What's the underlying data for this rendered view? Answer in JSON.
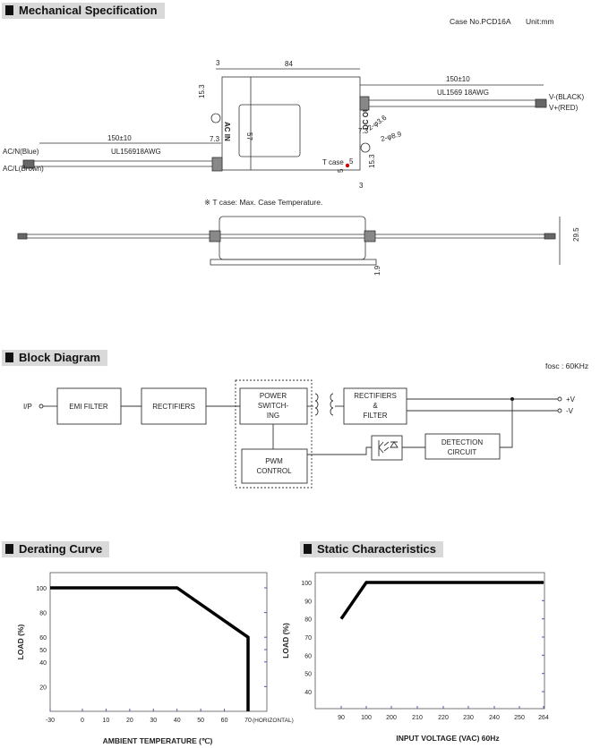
{
  "sections": {
    "mechanical": "Mechanical Specification",
    "block": "Block Diagram",
    "derating": "Derating Curve",
    "static": "Static Characteristics"
  },
  "mechanical": {
    "case_no": "Case No.PCD16A",
    "unit": "Unit:mm",
    "dim_84": "84",
    "dim_3_top": "3",
    "dim_15_3_left": "15.3",
    "dim_7_3_left": "7.3",
    "dim_57": "57",
    "ac_in": "AC IN",
    "dc_out": "DC OUT",
    "out_length": "150±10",
    "out_wire": "UL1569 18AWG",
    "v_black": "V-(BLACK)",
    "v_red": "V+(RED)",
    "in_length": "150±10",
    "in_wire": "UL156918AWG",
    "ac_n": "AC/N(Blue)",
    "ac_l": "AC/L(Brown)",
    "dim_7_3_right": "7.3",
    "hole_small": "2-φ3.6",
    "hole_large": "2-φ8.9",
    "tcase": "T case",
    "dim_5a": "5",
    "dim_5b": "5",
    "dim_15_3_right": "15.3",
    "dim_3_bottom": "3",
    "tcase_note": "※ T case: Max. Case Temperature.",
    "dim_29_5": "29.5",
    "dim_1_9": "1.9",
    "tcase_color": "#cc0000"
  },
  "block": {
    "fosc": "fosc : 60KHz",
    "ip": "I/P",
    "emi": "EMI FILTER",
    "rect1": "RECTIFIERS",
    "power": [
      "POWER",
      "SWITCH-",
      "ING"
    ],
    "pwm": [
      "PWM",
      "CONTROL"
    ],
    "rect2": [
      "RECTIFIERS",
      "&",
      "FILTER"
    ],
    "detect": [
      "DETECTION",
      "CIRCUIT"
    ],
    "pv": "+V",
    "nv": "-V"
  },
  "chart_data": [
    {
      "type": "line",
      "xlabel": "AMBIENT TEMPERATURE (℃)",
      "ylabel": "LOAD (%)",
      "x_ticks": [
        "-30",
        "0",
        "10",
        "20",
        "30",
        "40",
        "50",
        "60",
        "70"
      ],
      "x_suffix": "(HORIZONTAL)",
      "y_ticks": [
        "20",
        "40",
        "50",
        "60",
        "80",
        "100"
      ],
      "xlim": [
        -30,
        75
      ],
      "ylim": [
        0,
        110
      ],
      "series": [
        {
          "x": [
            -30,
            40,
            70,
            70
          ],
          "y": [
            100,
            100,
            60,
            0
          ]
        }
      ]
    },
    {
      "type": "line",
      "xlabel": "INPUT VOLTAGE (VAC) 60Hz",
      "ylabel": "LOAD (%)",
      "x_ticks": [
        "90",
        "100",
        "200",
        "210",
        "220",
        "230",
        "240",
        "250",
        "264"
      ],
      "y_ticks": [
        "40",
        "50",
        "60",
        "70",
        "80",
        "90",
        "100"
      ],
      "ylim": [
        35,
        105
      ],
      "series": [
        {
          "x": [
            "90",
            "100",
            "264"
          ],
          "y": [
            80,
            100,
            100
          ]
        }
      ]
    }
  ]
}
